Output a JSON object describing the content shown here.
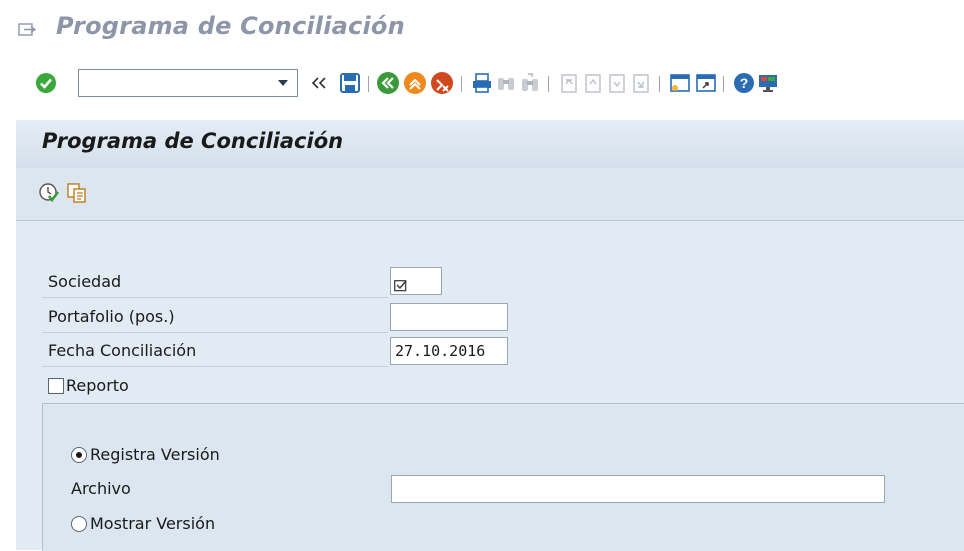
{
  "window": {
    "title": "Programa de Conciliación"
  },
  "toolbar": {
    "command_value": "",
    "icons": [
      "enter-icon",
      "command-dropdown-icon",
      "collapse-icon",
      "save-icon",
      "back-icon",
      "exit-icon",
      "cancel-icon",
      "print-icon",
      "find-icon",
      "find-next-icon",
      "first-page-icon",
      "previous-page-icon",
      "next-page-icon",
      "last-page-icon",
      "create-session-icon",
      "create-shortcut-icon",
      "help-icon",
      "customize-layout-icon"
    ]
  },
  "panel": {
    "title": "Programa de Conciliación",
    "app_toolbar_icons": [
      "execute-icon",
      "get-variant-icon"
    ]
  },
  "form": {
    "sociedad": {
      "label": "Sociedad",
      "value": ""
    },
    "portafolio": {
      "label": "Portafolio (pos.)",
      "value": ""
    },
    "fecha": {
      "label": "Fecha Conciliación",
      "value": "27.10.2016"
    },
    "reporto": {
      "label": "Reporto",
      "checked": false
    },
    "registra": {
      "label": "Registra Versión",
      "selected": true
    },
    "archivo": {
      "label": "Archivo",
      "value": ""
    },
    "mostrar": {
      "label": "Mostrar Versión",
      "selected": false
    }
  },
  "colors": {
    "panel_bg": "#dde7f1",
    "title_gray": "#8d96a8",
    "accent_green": "#2e9a2e",
    "accent_orange": "#e07b1a",
    "accent_red": "#c8401e",
    "accent_blue": "#2a6cb3"
  }
}
